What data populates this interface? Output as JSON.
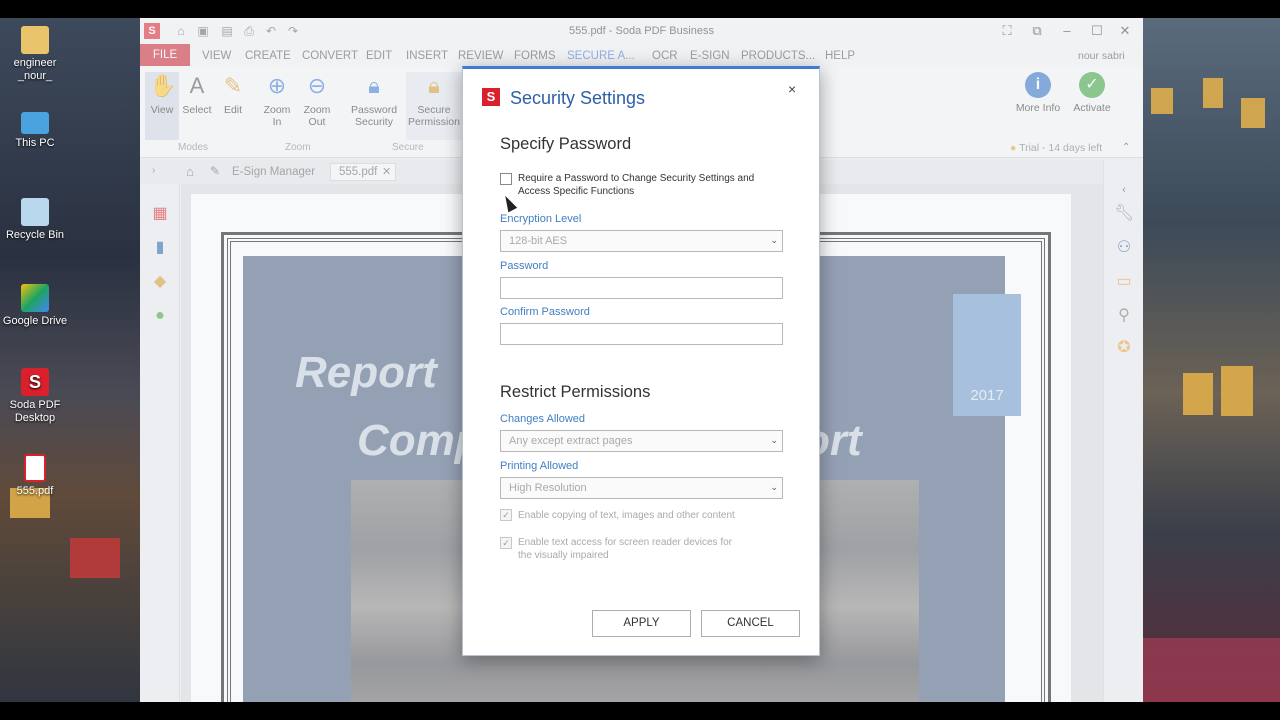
{
  "desktop": {
    "icons": [
      {
        "label": "engineer _nour_",
        "icon": "folder-icon"
      },
      {
        "label": "This PC",
        "icon": "computer-icon"
      },
      {
        "label": "Recycle Bin",
        "icon": "recycle-bin-icon"
      },
      {
        "label": "Google Drive",
        "icon": "google-drive-icon"
      },
      {
        "label": "Soda PDF Desktop",
        "icon": "soda-pdf-icon"
      },
      {
        "label": "555.pdf",
        "icon": "pdf-file-icon"
      }
    ]
  },
  "app": {
    "title": "555.pdf - Soda PDF Business",
    "user": "nour sabri",
    "menu": [
      "FILE",
      "VIEW",
      "CREATE",
      "CONVERT",
      "EDIT",
      "INSERT",
      "REVIEW",
      "FORMS",
      "SECURE A...",
      "OCR",
      "E-SIGN",
      "PRODUCTS...",
      "HELP"
    ],
    "ribbon": {
      "view": "View",
      "select": "Select",
      "edit": "Edit",
      "zoom_in": "Zoom In",
      "zoom_out": "Zoom Out",
      "password_security": "Password Security",
      "secure_permission": "Secure Permission",
      "more_info": "More Info",
      "activate": "Activate",
      "groups": {
        "modes": "Modes",
        "zoom": "Zoom",
        "secure": "Secure"
      }
    },
    "trial": "Trial - 14 days left",
    "tabs": {
      "esign": "E-Sign Manager",
      "doc": "555.pdf"
    }
  },
  "document": {
    "year": "2017",
    "title_line1": "Report",
    "title_line2": "Comp",
    "title_tail": "ort"
  },
  "dialog": {
    "title": "Security Settings",
    "close": "×",
    "specify_password_heading": "Specify Password",
    "require_password_label": "Require a Password to Change Security Settings and Access Specific Functions",
    "encryption_label": "Encryption Level",
    "encryption_value": "128-bit AES",
    "password_label": "Password",
    "password_value": "",
    "confirm_label": "Confirm Password",
    "confirm_value": "",
    "restrict_heading": "Restrict Permissions",
    "changes_label": "Changes Allowed",
    "changes_value": "Any except extract pages",
    "printing_label": "Printing Allowed",
    "printing_value": "High Resolution",
    "copy_label": "Enable copying of text, images and other content",
    "reader_label": "Enable text access for screen reader devices for the visually impaired",
    "apply": "APPLY",
    "cancel": "CANCEL"
  },
  "colors": {
    "accent": "#3d7bd6",
    "brand": "#d9202c",
    "label": "#3f7fc5"
  }
}
